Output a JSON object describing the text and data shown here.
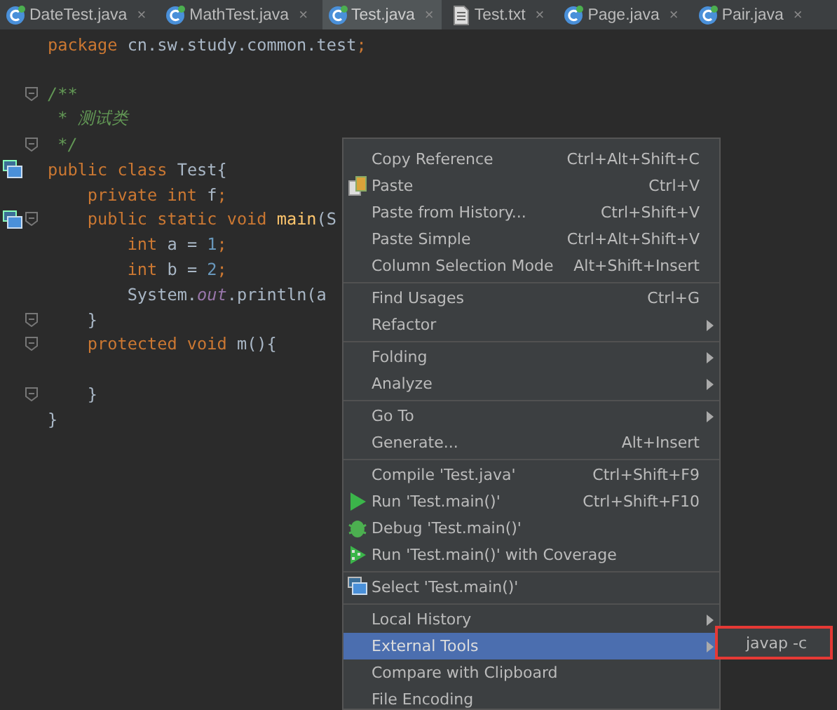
{
  "tabs": [
    {
      "label": "DateTest.java",
      "kind": "class",
      "selected": false,
      "close": "×"
    },
    {
      "label": "MathTest.java",
      "kind": "class",
      "selected": false,
      "close": "×"
    },
    {
      "label": "Test.java",
      "kind": "class",
      "selected": true,
      "close": "×"
    },
    {
      "label": "Test.txt",
      "kind": "text",
      "selected": false,
      "close": "×"
    },
    {
      "label": "Page.java",
      "kind": "class",
      "selected": false,
      "close": "×"
    },
    {
      "label": "Pair.java",
      "kind": "class",
      "selected": false,
      "close": "×"
    }
  ],
  "editor": {
    "lines": [
      {
        "tokens": [
          {
            "text": "package",
            "kind": "kw"
          },
          {
            "text": " cn.sw.study.common.test",
            "kind": "plain"
          },
          {
            "text": ";",
            "kind": "kw"
          }
        ]
      },
      {
        "kind": "blank"
      },
      {
        "fold": true,
        "tokens": [
          {
            "text": "/**",
            "kind": "doc"
          }
        ]
      },
      {
        "tokens": [
          {
            "text": " * 测试类",
            "kind": "doc"
          }
        ]
      },
      {
        "fold": true,
        "tokens": [
          {
            "text": " */",
            "kind": "doc"
          }
        ]
      },
      {
        "marker": true,
        "tokens": [
          {
            "text": "public class ",
            "kind": "kw"
          },
          {
            "text": "Test{",
            "kind": "plain"
          }
        ]
      },
      {
        "tokens": [
          {
            "text": "    private int ",
            "kind": "kw"
          },
          {
            "text": "f",
            "kind": "plain"
          },
          {
            "text": ";",
            "kind": "kw"
          }
        ]
      },
      {
        "marker": true,
        "fold": true,
        "tokens": [
          {
            "text": "    public static void ",
            "kind": "kw"
          },
          {
            "text": "main",
            "kind": "method"
          },
          {
            "text": "(S",
            "kind": "plain"
          }
        ]
      },
      {
        "tokens": [
          {
            "text": "        int ",
            "kind": "kw"
          },
          {
            "text": "a = ",
            "kind": "plain"
          },
          {
            "text": "1",
            "kind": "num"
          },
          {
            "text": ";",
            "kind": "kw"
          }
        ]
      },
      {
        "tokens": [
          {
            "text": "        int ",
            "kind": "kw"
          },
          {
            "text": "b = ",
            "kind": "plain"
          },
          {
            "text": "2",
            "kind": "num"
          },
          {
            "text": ";",
            "kind": "kw"
          }
        ]
      },
      {
        "tokens": [
          {
            "text": "        System.",
            "kind": "plain"
          },
          {
            "text": "out",
            "kind": "field"
          },
          {
            "text": ".println(a",
            "kind": "plain"
          }
        ]
      },
      {
        "fold": true,
        "tokens": [
          {
            "text": "    }",
            "kind": "plain"
          }
        ]
      },
      {
        "fold": true,
        "tokens": [
          {
            "text": "    protected void ",
            "kind": "kw"
          },
          {
            "text": "m",
            "kind": "plain"
          },
          {
            "text": "(){",
            "kind": "plain"
          }
        ]
      },
      {
        "kind": "blank"
      },
      {
        "fold": true,
        "tokens": [
          {
            "text": "    }",
            "kind": "plain"
          }
        ]
      },
      {
        "tokens": [
          {
            "text": "}",
            "kind": "plain"
          }
        ]
      }
    ]
  },
  "context_menu": {
    "items": [
      {
        "kind": "plain",
        "label": "Copy Reference",
        "shortcut": "Ctrl+Alt+Shift+C",
        "selected": false
      },
      {
        "kind": "paste",
        "label": "Paste",
        "shortcut": "Ctrl+V",
        "selected": false
      },
      {
        "kind": "plain",
        "label": "Paste from History...",
        "shortcut": "Ctrl+Shift+V",
        "selected": false
      },
      {
        "kind": "plain",
        "label": "Paste Simple",
        "shortcut": "Ctrl+Alt+Shift+V",
        "selected": false
      },
      {
        "kind": "plain",
        "label": "Column Selection Mode",
        "shortcut": "Alt+Shift+Insert",
        "selected": false
      },
      {
        "kind": "separator"
      },
      {
        "kind": "plain",
        "label": "Find Usages",
        "shortcut": "Ctrl+G",
        "selected": false
      },
      {
        "kind": "plain",
        "label": "Refactor",
        "submenu": true,
        "selected": false
      },
      {
        "kind": "separator"
      },
      {
        "kind": "plain",
        "label": "Folding",
        "submenu": true,
        "selected": false
      },
      {
        "kind": "plain",
        "label": "Analyze",
        "submenu": true,
        "selected": false
      },
      {
        "kind": "separator"
      },
      {
        "kind": "plain",
        "label": "Go To",
        "submenu": true,
        "selected": false
      },
      {
        "kind": "plain",
        "label": "Generate...",
        "shortcut": "Alt+Insert",
        "selected": false
      },
      {
        "kind": "separator"
      },
      {
        "kind": "plain",
        "label": "Compile 'Test.java'",
        "shortcut": "Ctrl+Shift+F9",
        "selected": false
      },
      {
        "kind": "run",
        "label": "Run 'Test.main()'",
        "shortcut": "Ctrl+Shift+F10",
        "selected": false
      },
      {
        "kind": "debug",
        "label": "Debug 'Test.main()'",
        "selected": false
      },
      {
        "kind": "coverage",
        "label": "Run 'Test.main()' with Coverage",
        "selected": false
      },
      {
        "kind": "separator"
      },
      {
        "kind": "select",
        "label": "Select 'Test.main()'",
        "selected": false
      },
      {
        "kind": "separator"
      },
      {
        "kind": "plain",
        "label": "Local History",
        "submenu": true,
        "selected": false
      },
      {
        "kind": "plain",
        "label": "External Tools",
        "submenu": true,
        "selected": true
      },
      {
        "kind": "plain",
        "label": "Compare with Clipboard",
        "selected": false
      },
      {
        "kind": "plain",
        "label": "File Encoding",
        "selected": false
      }
    ]
  },
  "submenu": {
    "outlined": true,
    "items": [
      {
        "label": "javap -c",
        "selected": false
      }
    ]
  }
}
